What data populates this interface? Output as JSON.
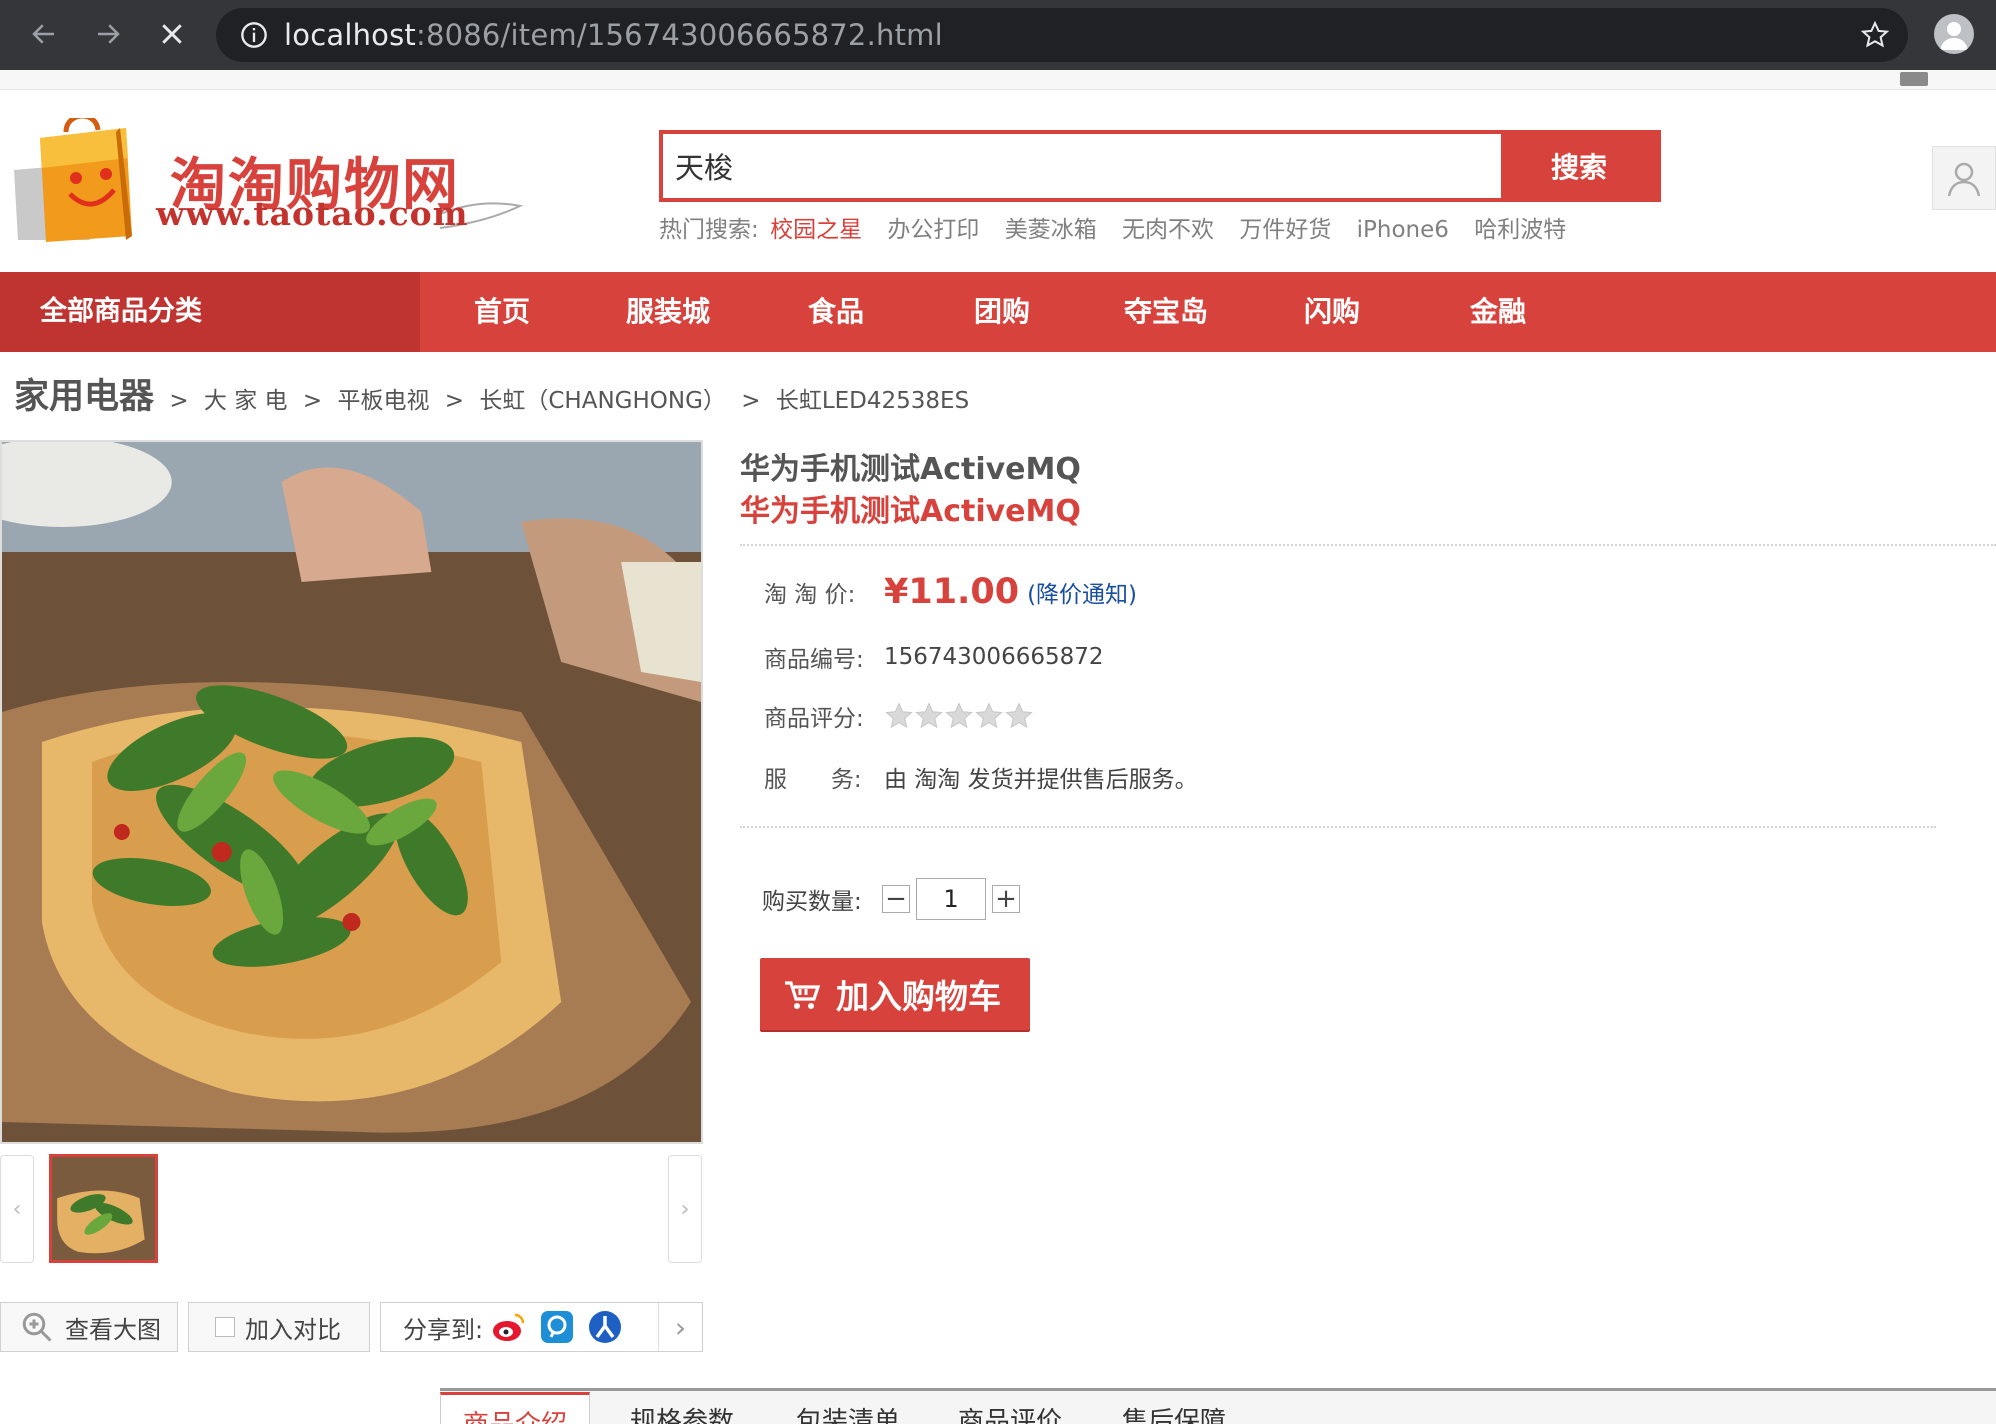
{
  "browser": {
    "url_host": "localhost",
    "url_path": ":8086/item/156743006665872.html"
  },
  "header": {
    "logo_title": "淘淘购物网",
    "logo_url": "www.taotao.com",
    "search_value": "天梭",
    "search_button": "搜索",
    "hot_label": "热门搜索:",
    "hot_words": [
      "校园之星",
      "办公打印",
      "美菱冰箱",
      "无肉不欢",
      "万件好货",
      "iPhone6",
      "哈利波特"
    ]
  },
  "nav": {
    "all_categories": "全部商品分类",
    "links": [
      "首页",
      "服装城",
      "食品",
      "团购",
      "夺宝岛",
      "闪购",
      "金融"
    ]
  },
  "breadcrumb": {
    "root": "家用电器",
    "items": [
      "大 家 电",
      "平板电视",
      "长虹（CHANGHONG）",
      "长虹LED42538ES"
    ],
    "sep": ">"
  },
  "gallery": {
    "zoom_label": "查看大图",
    "compare_label": "加入对比",
    "share_label": "分享到:"
  },
  "product": {
    "name": "华为手机测试ActiveMQ",
    "subtitle": "华为手机测试ActiveMQ",
    "price_label": "淘 淘 价:",
    "price": "¥11.00",
    "price_notice": "(降价通知)",
    "id_label": "商品编号:",
    "id": "156743006665872",
    "rating_label": "商品评分:",
    "rating": 0,
    "service_label": "服      务:",
    "service": "由 淘淘 发货并提供售后服务。",
    "qty_label": "购买数量:",
    "qty": "1",
    "cart_button": "加入购物车"
  },
  "tabs": [
    "商品介绍",
    "规格参数",
    "包装清单",
    "商品评价",
    "售后保障"
  ],
  "colors": {
    "brand": "#d8423c",
    "dark_brand": "#bf3430",
    "link_blue": "#1a4fa0"
  }
}
